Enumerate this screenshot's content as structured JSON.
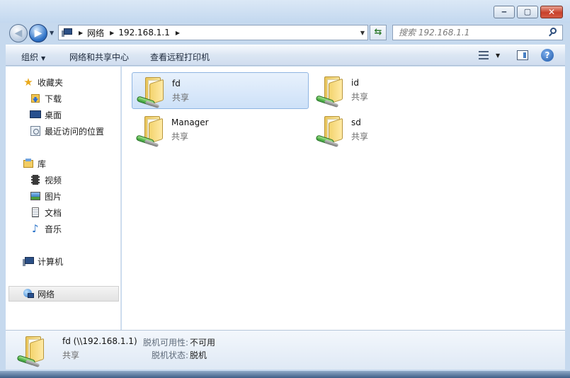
{
  "address": {
    "crumbs": [
      "网络",
      "192.168.1.1"
    ],
    "search_placeholder": "搜索 192.168.1.1"
  },
  "toolbar": {
    "organize": "组织",
    "network_center": "网络和共享中心",
    "remote_printers": "查看远程打印机"
  },
  "nav": {
    "favorites": "收藏夹",
    "downloads": "下载",
    "desktop": "桌面",
    "recent": "最近访问的位置",
    "libraries": "库",
    "videos": "视频",
    "pictures": "图片",
    "documents": "文档",
    "music": "音乐",
    "computer": "计算机",
    "network": "网络"
  },
  "items": [
    {
      "name": "fd",
      "sub": "共享"
    },
    {
      "name": "id",
      "sub": "共享"
    },
    {
      "name": "Manager",
      "sub": "共享"
    },
    {
      "name": "sd",
      "sub": "共享"
    }
  ],
  "details": {
    "title": "fd (\\\\192.168.1.1)",
    "sub": "共享",
    "offline_avail_label": "脱机可用性:",
    "offline_avail_value": "不可用",
    "offline_status_label": "脱机状态:",
    "offline_status_value": "脱机"
  }
}
